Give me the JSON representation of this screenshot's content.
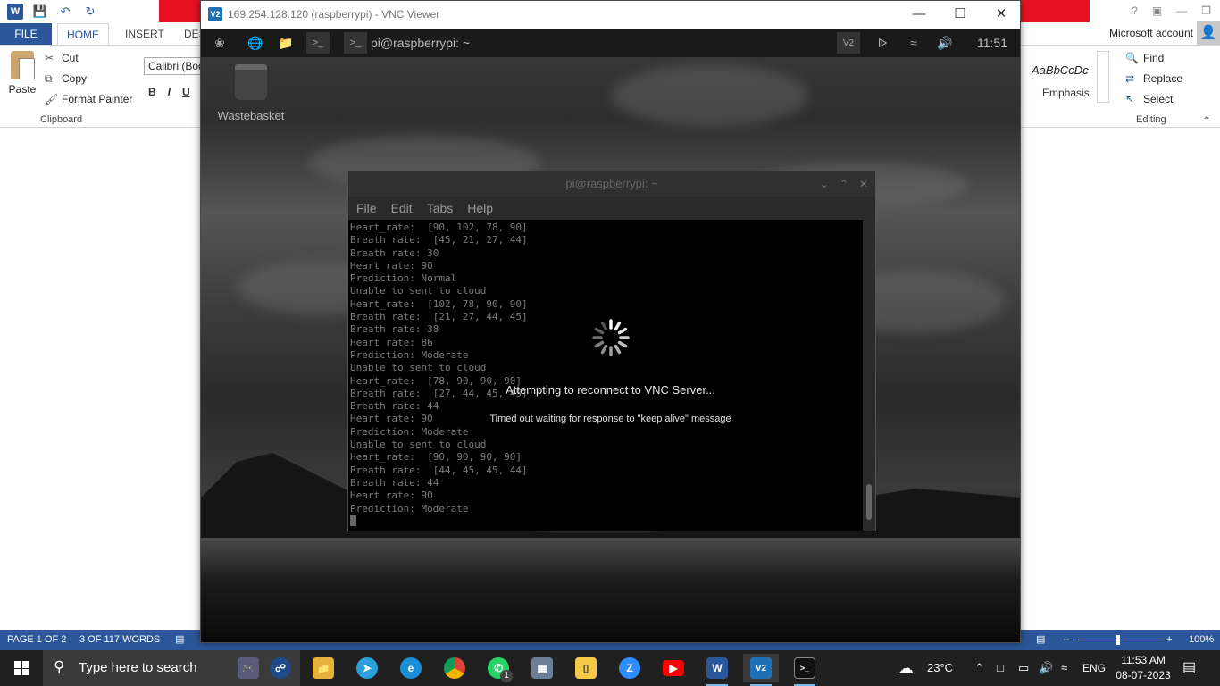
{
  "word": {
    "tabs": [
      "FILE",
      "HOME",
      "INSERT",
      "DES"
    ],
    "account": "Microsoft account",
    "clipboard": {
      "paste": "Paste",
      "cut": "Cut",
      "copy": "Copy",
      "format_painter": "Format Painter",
      "group_label": "Clipboard"
    },
    "font_name": "Calibri (Bod",
    "format_buttons": [
      "B",
      "I",
      "U"
    ],
    "styles": {
      "sample": "AaBbCcDc",
      "name": "Emphasis"
    },
    "editing": {
      "find": "Find",
      "replace": "Replace",
      "select": "Select",
      "group_label": "Editing"
    },
    "status": {
      "page": "PAGE 1 OF 2",
      "words": "3 OF 117 WORDS",
      "zoom": "100%"
    }
  },
  "vnc": {
    "window_title": "169.254.128.120 (raspberrypi) - VNC Viewer",
    "pi_taskbar": {
      "terminal_label": "pi@raspberrypi: ~",
      "clock": "11:51"
    },
    "desktop_icon": "Wastebasket",
    "terminal": {
      "title": "pi@raspberrypi: ~",
      "menu": [
        "File",
        "Edit",
        "Tabs",
        "Help"
      ],
      "lines": [
        "Heart_rate:  [90, 102, 78, 90]",
        "Breath rate:  [45, 21, 27, 44]",
        "Breath rate: 30",
        "Heart rate: 90",
        "Prediction: Normal",
        "Unable to sent to cloud",
        "Heart_rate:  [102, 78, 90, 90]",
        "Breath rate:  [21, 27, 44, 45]",
        "Breath rate: 38",
        "Heart rate: 86",
        "Prediction: Moderate",
        "Unable to sent to cloud",
        "Heart_rate:  [78, 90, 90, 90]",
        "Breath rate:  [27, 44, 45, 45]",
        "Breath rate: 44",
        "Heart rate: 90",
        "Prediction: Moderate",
        "Unable to sent to cloud",
        "Heart_rate:  [90, 90, 90, 90]",
        "Breath rate:  [44, 45, 45, 44]",
        "Breath rate: 44",
        "Heart rate: 90",
        "Prediction: Moderate"
      ]
    },
    "reconnect": {
      "title": "Attempting to reconnect to VNC Server...",
      "message": "Timed out waiting for response to \"keep alive\" message"
    }
  },
  "windows_taskbar": {
    "search_placeholder": "Type here to search",
    "weather": "23°C",
    "language": "ENG",
    "time": "11:53 AM",
    "date": "08-07-2023",
    "whatsapp_badge": "1"
  }
}
